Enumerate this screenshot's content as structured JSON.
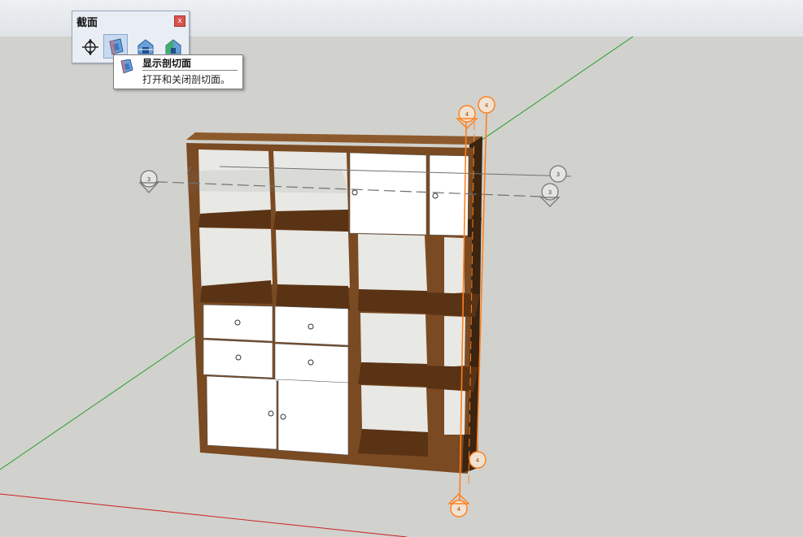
{
  "toolbar": {
    "title": "截面",
    "close_label": "x",
    "buttons": [
      {
        "icon": "section-plane-icon"
      },
      {
        "icon": "display-section-planes-icon",
        "active": true
      },
      {
        "icon": "display-section-cuts-icon"
      },
      {
        "icon": "display-section-fill-icon"
      }
    ]
  },
  "tooltip": {
    "title": "显示剖切面",
    "description": "打开和关闭剖切面。"
  },
  "scene": {
    "section_markers": [
      {
        "id": "left-marker",
        "label": "3"
      },
      {
        "id": "right-upper-marker",
        "label": "3"
      },
      {
        "id": "right-lower-marker",
        "label": "3"
      },
      {
        "id": "top-marker-a",
        "label": "4"
      },
      {
        "id": "top-marker-b",
        "label": "4"
      },
      {
        "id": "bottom-marker-a",
        "label": "4"
      },
      {
        "id": "bottom-marker-b",
        "label": "4"
      }
    ],
    "colors": {
      "wood": "#7a4a22",
      "wood_dark": "#5a3315",
      "door": "#ffffff",
      "section_orange": "#ff7f1a",
      "section_gray": "#707070",
      "axis_green": "#2aa02a",
      "axis_red": "#cc2222"
    }
  }
}
